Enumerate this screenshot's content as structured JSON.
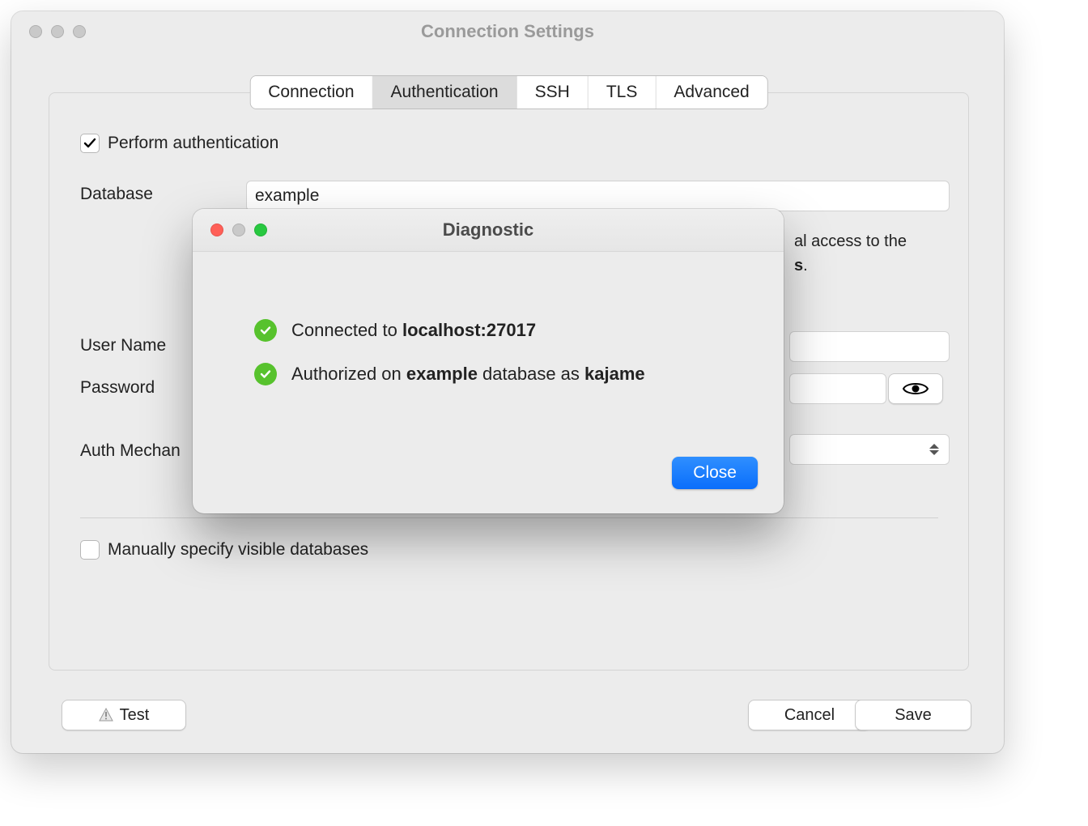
{
  "outer": {
    "title": "Connection Settings"
  },
  "tabs": {
    "items": [
      "Connection",
      "Authentication",
      "SSH",
      "TLS",
      "Advanced"
    ],
    "selected_index": 1
  },
  "auth": {
    "perform_checked": true,
    "perform_label": "Perform authentication",
    "database_label": "Database",
    "database_value": "example",
    "helper_part1": "al access to the",
    "helper_part2": "s",
    "username_label": "User Name",
    "password_label": "Password",
    "mechanism_label": "Auth Mechan",
    "manually_label": "Manually specify visible databases",
    "manually_checked": false
  },
  "dialog": {
    "title": "Diagnostic",
    "row1_prefix": "Connected to ",
    "row1_bold": "localhost:27017",
    "row2_prefix": "Authorized on ",
    "row2_bold1": "example",
    "row2_mid": " database as ",
    "row2_bold2": "kajame",
    "close": "Close"
  },
  "footer": {
    "test": "Test",
    "cancel": "Cancel",
    "save": "Save"
  }
}
